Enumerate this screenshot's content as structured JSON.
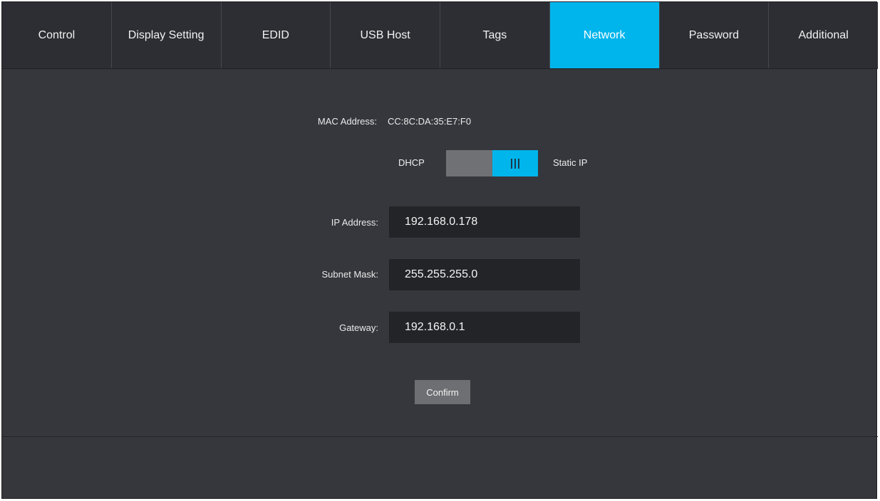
{
  "tabs": [
    {
      "label": "Control"
    },
    {
      "label": "Display Setting"
    },
    {
      "label": "EDID"
    },
    {
      "label": "USB Host"
    },
    {
      "label": "Tags"
    },
    {
      "label": "Network",
      "active": true
    },
    {
      "label": "Password"
    },
    {
      "label": "Additional"
    }
  ],
  "network": {
    "mac_label": "MAC Address:",
    "mac_value": "CC:8C:DA:35:E7:F0",
    "mode_left": "DHCP",
    "mode_right": "Static IP",
    "mode_selected": "Static IP",
    "ip_label": "IP Address:",
    "ip_value": "192.168.0.178",
    "mask_label": "Subnet Mask:",
    "mask_value": "255.255.255.0",
    "gateway_label": "Gateway:",
    "gateway_value": "192.168.0.1",
    "confirm_label": "Confirm"
  },
  "colors": {
    "accent": "#00b4ec",
    "background": "#35373c",
    "input_background": "#232428"
  }
}
